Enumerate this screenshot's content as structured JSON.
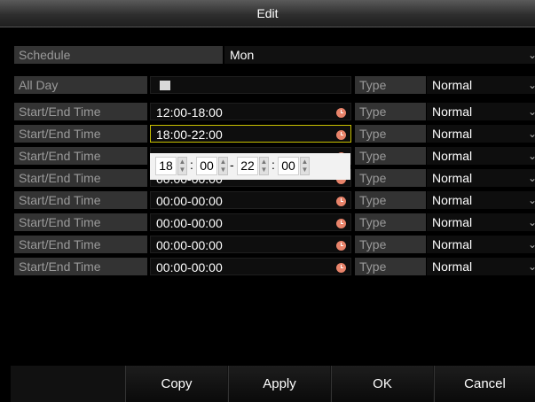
{
  "window": {
    "title": "Edit"
  },
  "schedule": {
    "label": "Schedule",
    "value": "Mon"
  },
  "all_day": {
    "label": "All Day",
    "checked": true
  },
  "type_label": "Type",
  "rows": [
    {
      "label": "Start/End Time",
      "time": "12:00-18:00",
      "type": "Normal"
    },
    {
      "label": "Start/End Time",
      "time": "18:00-22:00",
      "type": "Normal"
    },
    {
      "label": "Start/End Time",
      "time": "",
      "type": "Normal"
    },
    {
      "label": "Start/End Time",
      "time": "00:00-00:00",
      "type": "Normal"
    },
    {
      "label": "Start/End Time",
      "time": "00:00-00:00",
      "type": "Normal"
    },
    {
      "label": "Start/End Time",
      "time": "00:00-00:00",
      "type": "Normal"
    },
    {
      "label": "Start/End Time",
      "time": "00:00-00:00",
      "type": "Normal"
    },
    {
      "label": "Start/End Time",
      "time": "00:00-00:00",
      "type": "Normal"
    }
  ],
  "all_day_type": "Normal",
  "time_editor": {
    "start_hour": "18",
    "start_min": "00",
    "end_hour": "22",
    "end_min": "00",
    "colon": ":",
    "dash": "-"
  },
  "buttons": {
    "copy": "Copy",
    "apply": "Apply",
    "ok": "OK",
    "cancel": "Cancel"
  },
  "icons": {
    "clock": "clock-icon",
    "chevron": "chevron-down-icon",
    "spinner": "spinner-arrows-icon"
  },
  "colors": {
    "selection_border": "#c8c000",
    "clock": "#e8836a"
  }
}
